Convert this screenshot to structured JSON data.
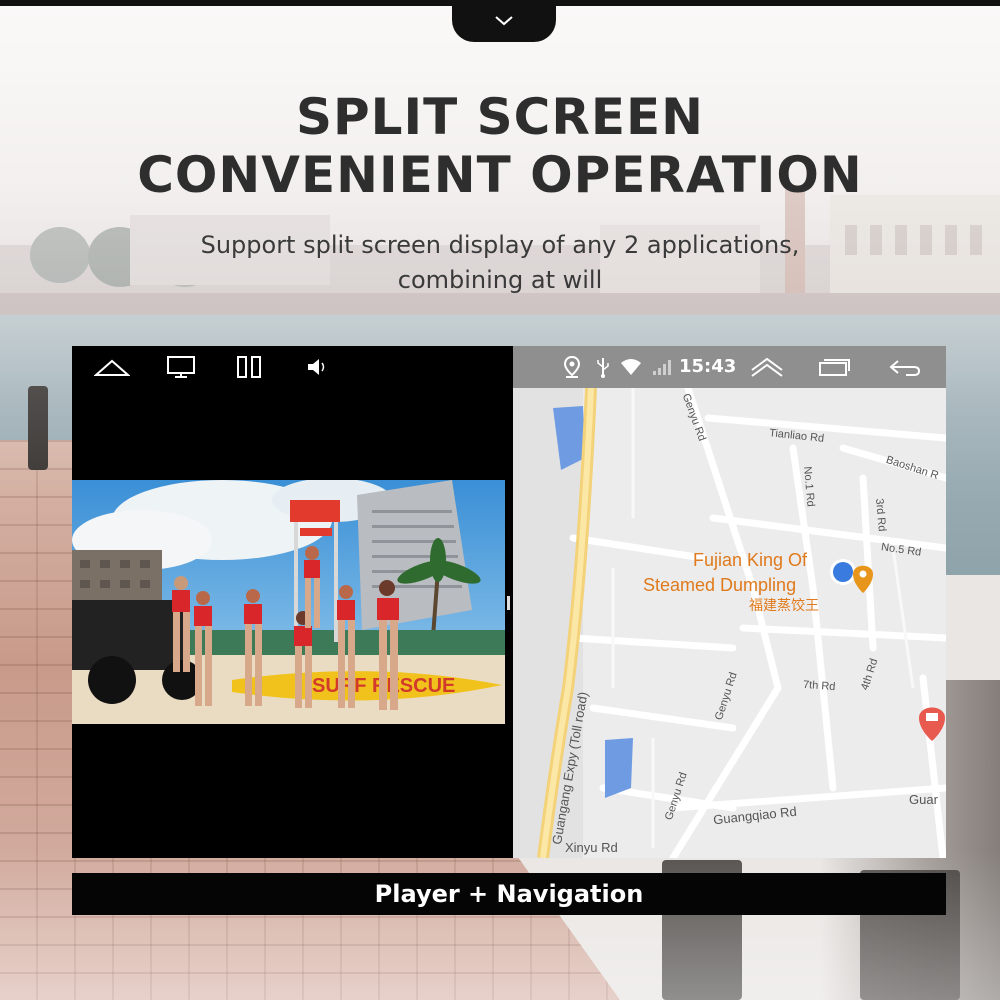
{
  "header": {
    "title_line1": "SPLIT SCREEN",
    "title_line2": "CONVENIENT OPERATION",
    "subtitle_line1": "Support split screen display of any 2 applications,",
    "subtitle_line2": "combining at will"
  },
  "pull_tab": {
    "icon": "chevron-down-icon"
  },
  "left_pane": {
    "nav_icons": [
      "home-icon",
      "screen-icon",
      "split-screen-icon",
      "volume-icon"
    ],
    "video": {
      "sign_text": "SURF RESCUE"
    }
  },
  "right_pane": {
    "status": {
      "time": "15:43",
      "icons": [
        "location-icon",
        "usb-icon",
        "wifi-icon",
        "signal-icon",
        "expand-icon",
        "recent-apps-icon",
        "back-icon"
      ]
    },
    "map": {
      "poi_name_line1": "Fujian King Of",
      "poi_name_line2": "Steamed Dumpling",
      "poi_name_cn": "福建蒸饺王",
      "streets": {
        "genyu_top": "Genyu Rd",
        "tianliao": "Tianliao Rd",
        "baoshan": "Baoshan R",
        "no1": "No.1 Rd",
        "third": "3rd Rd",
        "no5": "No.5 Rd",
        "genyu_mid": "Genyu Rd",
        "fourth": "4th Rd",
        "seventh": "7th Rd",
        "expy": "Guangang Expy (Toll road)",
        "genyu_low": "Genyu Rd",
        "guangqiao": "Guangqiao Rd",
        "guan_edge": "Guar",
        "xinyu": "Xinyu Rd"
      }
    }
  },
  "caption": "Player + Navigation",
  "colors": {
    "poi_text": "#e07a1c",
    "status_bar": "#8f8f8f",
    "expressway": "#f3d27a",
    "water": "#6f9be3",
    "current_location": "#3a7be0",
    "destination_pin": "#e85a4f"
  }
}
